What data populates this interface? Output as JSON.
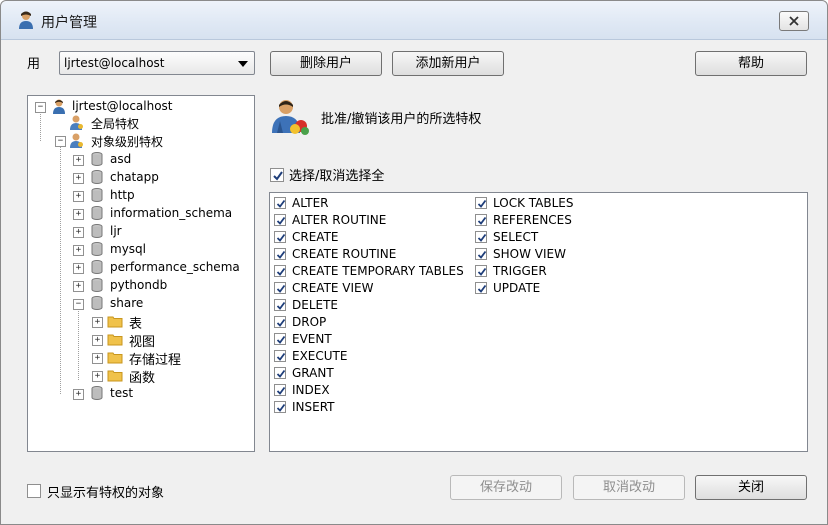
{
  "window": {
    "title": "用户管理"
  },
  "user_row": {
    "label": "用",
    "selected_user": "ljrtest@localhost"
  },
  "buttons": {
    "delete_user": "删除用户",
    "add_user": "添加新用户",
    "help": "帮助",
    "save": "保存改动",
    "cancel": "取消改动",
    "close": "关闭"
  },
  "tree": {
    "root": "ljrtest@localhost",
    "global": "全局特权",
    "object_level": "对象级别特权",
    "databases": [
      "asd",
      "chatapp",
      "http",
      "information_schema",
      "ljr",
      "mysql",
      "performance_schema",
      "pythondb",
      "share",
      "test"
    ],
    "share_children": [
      "表",
      "视图",
      "存储过程",
      "函数"
    ]
  },
  "header_text": "批准/撤销该用户的所选特权",
  "select_all_label": "选择/取消选择全",
  "privileges_col1": [
    "ALTER",
    "ALTER ROUTINE",
    "CREATE",
    "CREATE ROUTINE",
    "CREATE TEMPORARY TABLES",
    "CREATE VIEW",
    "DELETE",
    "DROP",
    "EVENT",
    "EXECUTE",
    "GRANT",
    "INDEX",
    "INSERT"
  ],
  "privileges_col2": [
    "LOCK TABLES",
    "REFERENCES",
    "SELECT",
    "SHOW VIEW",
    "TRIGGER",
    "UPDATE"
  ],
  "only_show_privileged": "只显示有特权的对象"
}
